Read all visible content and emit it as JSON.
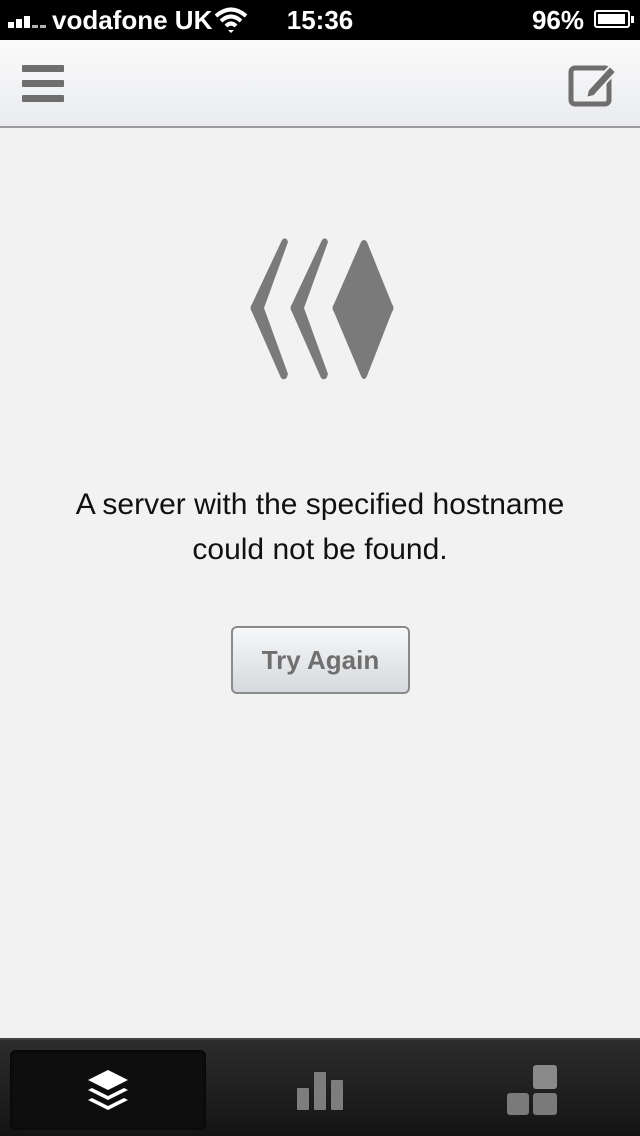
{
  "status_bar": {
    "carrier": "vodafone UK",
    "time": "15:36",
    "battery_percent": "96%",
    "battery_level": 0.96,
    "signal_bars": 3
  },
  "nav_bar": {
    "menu_icon": "hamburger-menu-icon",
    "compose_icon": "compose-icon"
  },
  "main": {
    "logo_icon": "buffer-logo-icon",
    "error_message": "A server with the specified hostname could not be found.",
    "try_again_label": "Try Again"
  },
  "tab_bar": {
    "tabs": [
      {
        "icon": "layers-icon",
        "active": true
      },
      {
        "icon": "bar-chart-icon",
        "active": false
      },
      {
        "icon": "blocks-icon",
        "active": false
      }
    ]
  },
  "colors": {
    "background": "#f2f2f2",
    "status_bar": "#000000",
    "icon_gray": "#6e6e6e",
    "tab_bar": "#1c1c1c"
  }
}
